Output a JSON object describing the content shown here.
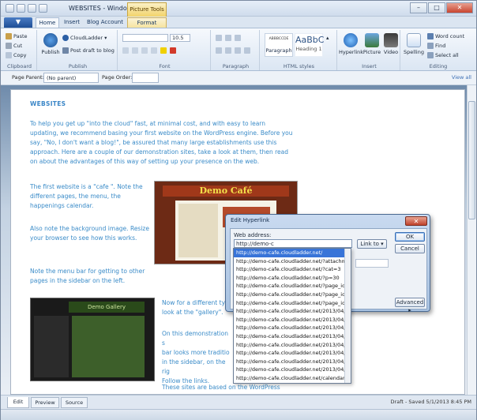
{
  "titlebar": {
    "title": "WEBSITES - Windows Live ...",
    "context_tab": "Picture Tools",
    "minimize": "–",
    "maximize": "□",
    "close": "✕"
  },
  "tabs": {
    "app": "▼",
    "items": [
      "Home",
      "Insert",
      "Blog Account",
      "Format"
    ]
  },
  "ribbon": {
    "clipboard": {
      "label": "Clipboard",
      "paste": "Paste",
      "cut": "Cut",
      "copy": "Copy"
    },
    "publish": {
      "label": "Publish",
      "publish": "Publish",
      "account": "CloudLadder",
      "draft": "Post draft to blog"
    },
    "font": {
      "label": "Font",
      "size": "10.5"
    },
    "paragraph": {
      "label": "Paragraph"
    },
    "html_styles": {
      "label": "HTML styles",
      "paragraph": "Paragraph",
      "heading1": "Heading 1",
      "sample": "AaBbC",
      "sample_small": "ABBBCCDE"
    },
    "insert": {
      "label": "Insert",
      "hyperlink": "Hyperlink",
      "picture": "Picture",
      "video": "Video"
    },
    "editing": {
      "label": "Editing",
      "spelling": "Spelling",
      "word_count": "Word count",
      "find": "Find",
      "select_all": "Select all"
    }
  },
  "pagebar": {
    "parent_label": "Page Parent:",
    "parent_value": "(No parent)",
    "order_label": "Page Order:",
    "order_value": "",
    "view_all": "View all"
  },
  "doc": {
    "heading": "WEBSITES",
    "p1": "To help you get up \"into the cloud\" fast, at minimal cost, and with easy to learn updating, we recommend basing your first website on the WordPress engine. Before you say, \"No, I don't want a blog!\", be assured that many large establishments use this approach. Here are a couple of our demonstration sites, take a look at them, then read on about the advantages of this way of setting up your presence on the web.",
    "p2": "The first website is a \"cafe \". Note the different pages, the menu, the happenings calendar.",
    "p3": "Also note the background image. Resize your browser to see how this works.",
    "p4": "Note the menu bar for getting to other pages in the sidebar on the left.",
    "p5a": "Now for a different ty",
    "p5b": "look at the \"gallery\".",
    "p6a": "On this demonstration s",
    "p6b": "bar looks more traditio",
    "p6c": "in the sidebar, on the rig",
    "p6d": "Follow the links.",
    "p7": "These sites are based on the WordPress",
    "img1_title": "Demo Café",
    "img2_title": "Demo Gallery"
  },
  "dialog": {
    "title": "Edit Hyperlink",
    "close": "✕",
    "web_address_label": "Web address:",
    "web_address_value": "http://demo-c",
    "link_to": "Link to ▾",
    "ok": "OK",
    "cancel": "Cancel",
    "advanced": "Advanced ▸",
    "suggestions": [
      "http://demo-cafe.cloudladder.net/",
      "http://demo-cafe.cloudladder.net/?attachment_",
      "http://demo-cafe.cloudladder.net/?cat=3",
      "http://demo-cafe.cloudladder.net/?p=30",
      "http://demo-cafe.cloudladder.net/?page_id=12",
      "http://demo-cafe.cloudladder.net/?page_id=18",
      "http://demo-cafe.cloudladder.net/?page_id=9",
      "http://demo-cafe.cloudladder.net/2013/04/19/",
      "http://demo-cafe.cloudladder.net/2013/04/21/",
      "http://demo-cafe.cloudladder.net/2013/04/bee",
      "http://demo-cafe.cloudladder.net/2013/04/dire",
      "http://demo-cafe.cloudladder.net/2013/04/kate",
      "http://demo-cafe.cloudladder.net/2013/04/parl",
      "http://demo-cafe.cloudladder.net/2013/04/ray-",
      "http://demo-cafe.cloudladder.net/2013/04/win",
      "http://demo-cafe.cloudladder.net/calendar/"
    ]
  },
  "bottom": {
    "tabs": [
      "Edit",
      "Preview",
      "Source"
    ],
    "status": "Draft - Saved 5/1/2013 8:45 PM"
  }
}
